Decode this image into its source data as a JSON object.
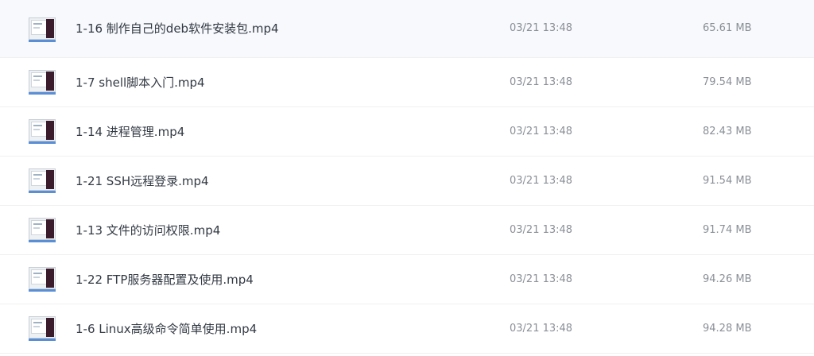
{
  "files": [
    {
      "name": "1-16 制作自己的deb软件安装包.mp4",
      "date": "03/21 13:48",
      "size": "65.61 MB",
      "icon": "video-thumbnail-icon"
    },
    {
      "name": "1-7 shell脚本入门.mp4",
      "date": "03/21 13:48",
      "size": "79.54 MB",
      "icon": "video-thumbnail-icon"
    },
    {
      "name": "1-14 进程管理.mp4",
      "date": "03/21 13:48",
      "size": "82.43 MB",
      "icon": "video-thumbnail-icon"
    },
    {
      "name": "1-21 SSH远程登录.mp4",
      "date": "03/21 13:48",
      "size": "91.54 MB",
      "icon": "video-thumbnail-icon"
    },
    {
      "name": "1-13 文件的访问权限.mp4",
      "date": "03/21 13:48",
      "size": "91.74 MB",
      "icon": "video-thumbnail-icon"
    },
    {
      "name": "1-22 FTP服务器配置及使用.mp4",
      "date": "03/21 13:48",
      "size": "94.26 MB",
      "icon": "video-thumbnail-icon"
    },
    {
      "name": "1-6 Linux高级命令简单使用.mp4",
      "date": "03/21 13:48",
      "size": "94.28 MB",
      "icon": "video-thumbnail-icon"
    }
  ]
}
